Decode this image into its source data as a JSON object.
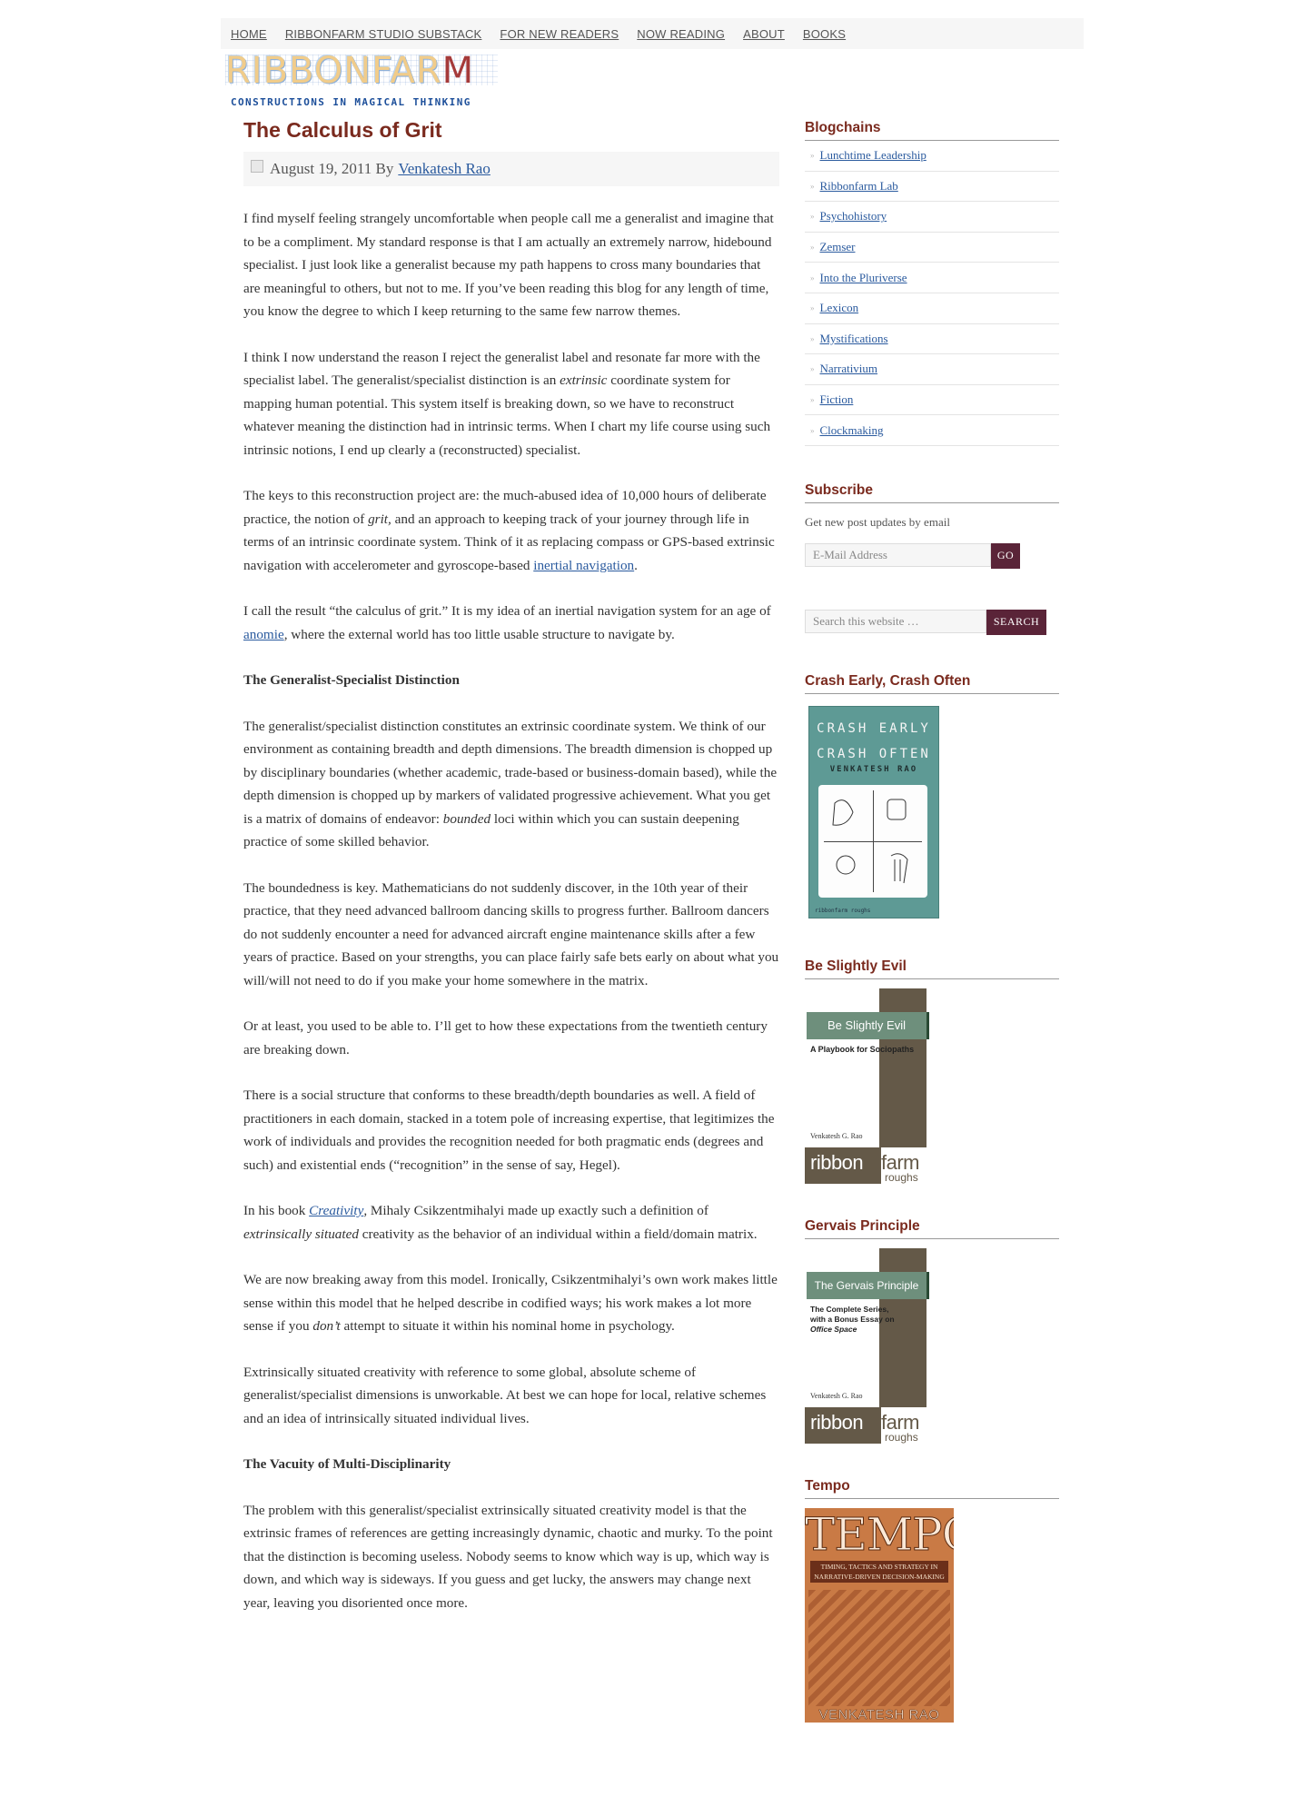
{
  "nav": {
    "items": [
      "HOME",
      "RIBBONFARM STUDIO SUBSTACK",
      "FOR NEW READERS",
      "NOW READING",
      "ABOUT",
      "BOOKS"
    ]
  },
  "logo": {
    "name": "RIBBONFARM",
    "tagline": "CONSTRUCTIONS IN MAGICAL THINKING"
  },
  "post": {
    "title": "The Calculus of Grit",
    "date": "August 19, 2011",
    "by": "By",
    "author": "Venkatesh Rao",
    "p1": "I find myself feeling strangely uncomfortable when people call me a generalist and imagine that to be a compliment.  My standard response is that I am actually an extremely narrow, hidebound specialist. I just look like a generalist because my path happens to cross many boundaries that are meaningful to others, but not to me. If you’ve been reading this blog for any length of time, you know the degree to which I keep returning to the same few narrow themes.",
    "p2a": "I think I now understand the reason I reject the generalist label and resonate far more with the specialist label. The generalist/specialist distinction is an ",
    "p2em": "extrinsic",
    "p2b": " coordinate system for mapping human potential.  This system itself is breaking down, so we have to reconstruct whatever meaning the distinction had in intrinsic terms. When I chart my life course using such intrinsic notions, I end up clearly a (reconstructed) specialist.",
    "p3a": "The keys to this reconstruction project are: the much-abused idea of 10,000 hours of deliberate practice, the notion of ",
    "p3em": "grit,",
    "p3b": " and an approach to keeping track of your journey through life in terms of an intrinsic coordinate system. Think of it as replacing compass or GPS-based extrinsic navigation with accelerometer and gyroscope-based  ",
    "p3link": "inertial navigation",
    "p3c": ".",
    "p4a": "I call the result “the calculus of grit.” It is my idea of an inertial navigation system for an age of ",
    "p4link": "anomie",
    "p4b": ", where the external world has too little usable structure to navigate by.",
    "h1": "The Generalist-Specialist Distinction",
    "p5a": "The generalist/specialist distinction constitutes an extrinsic coordinate system. We think of our environment as containing breadth and depth dimensions. The breadth dimension is chopped up by disciplinary boundaries (whether academic, trade-based or business-domain based), while the depth dimension is chopped up by markers of validated progressive achievement. What you get is a matrix of domains of endeavor: ",
    "p5em": "bounded",
    "p5b": " loci within which you can sustain deepening practice of some skilled behavior.",
    "p6": "The boundedness is key. Mathematicians do not suddenly discover, in the 10th year of their practice, that they need advanced ballroom dancing skills to progress further. Ballroom dancers do not suddenly encounter a need for advanced aircraft engine maintenance skills after a few years of practice. Based on your strengths, you can place fairly safe bets early on about what you will/will not need to do if you make your home somewhere in the matrix.",
    "p7": "Or at least, you used to be able to. I’ll get to how these expectations from the twentieth century are breaking down.",
    "p8": "There is a social structure that conforms to these breadth/depth boundaries as well. A field of practitioners in each domain, stacked in a totem pole of increasing expertise, that legitimizes the work of individuals and provides the recognition needed for both pragmatic ends (degrees and such) and existential ends (“recognition” in the sense of say, Hegel).",
    "p9a": "In his book ",
    "p9link": "Creativity",
    "p9b": ", Mihaly Csikzentmihalyi made up exactly such a definition of ",
    "p9em": "extrinsically situated",
    "p9c": " creativity as the behavior of an individual within a field/domain matrix.",
    "p10a": "We are now breaking away from this model. Ironically, Csikzentmihalyi’s own work makes little sense within this model that he helped describe in codified ways; his work makes a lot more sense if you ",
    "p10em": "don’t",
    "p10b": " attempt to situate it within his nominal home in psychology.",
    "p11": "Extrinsically situated creativity with reference to some global, absolute scheme of generalist/specialist dimensions is unworkable. At best we can hope for local, relative schemes and an idea of intrinsically situated individual lives.",
    "h2": "The Vacuity of Multi-Disciplinarity",
    "p12": "The problem with this generalist/specialist extrinsically situated creativity model is that the extrinsic frames of references are getting increasingly dynamic, chaotic and murky. To the point that the distinction is becoming useless. Nobody seems to know which way is up, which way is down, and which way is sideways. If you guess and get lucky, the answers may change next year, leaving you disoriented once more."
  },
  "sidebar": {
    "blogchains_title": "Blogchains",
    "blogchains": [
      "Lunchtime Leadership",
      "Ribbonfarm Lab",
      "Psychohistory",
      "Zemser",
      "Into the Pluriverse",
      "Lexicon",
      "Mystifications",
      "Narrativium",
      "Fiction",
      "Clockmaking"
    ],
    "subscribe_title": "Subscribe",
    "subscribe_text": "Get new post updates by email",
    "email_placeholder": "E-Mail Address",
    "go_label": "GO",
    "search_placeholder": "Search this website …",
    "search_label": "SEARCH",
    "crash_title": "Crash Early, Crash Often",
    "crash_cover": {
      "line1": "CRASH EARLY",
      "line2": "CRASH OFTEN",
      "author": "VENKATESH RAO",
      "footer": "ribbonfarm roughs"
    },
    "evil_title": "Be Slightly Evil",
    "evil_cover": {
      "title": "Be Slightly Evil",
      "subtitle": "A Playbook for Sociopaths",
      "author": "Venkatesh G. Rao",
      "brand1": "ribbon",
      "brand2": "farm",
      "brand3": "roughs"
    },
    "gervais_title": "Gervais Principle",
    "gervais_cover": {
      "title": "The Gervais Principle",
      "subtitle1": "The Complete Series,",
      "subtitle2": "with a Bonus Essay on",
      "subtitle3": "Office Space",
      "author": "Venkatesh G. Rao",
      "brand1": "ribbon",
      "brand2": "farm",
      "brand3": "roughs"
    },
    "tempo_title": "Tempo",
    "tempo_cover": {
      "title": "TEMPO",
      "tag1": "TIMING, TACTICS AND STRATEGY IN",
      "tag2": "NARRATIVE-DRIVEN DECISION-MAKING",
      "author": "VENKATESH RAO"
    }
  },
  "colors": {
    "title": "#7a2a1e",
    "link": "#2a5a9e",
    "button": "#5a2438",
    "cover_teal": "#5e9a95",
    "cover_brown": "#645948",
    "cover_orange": "#c97a45"
  }
}
